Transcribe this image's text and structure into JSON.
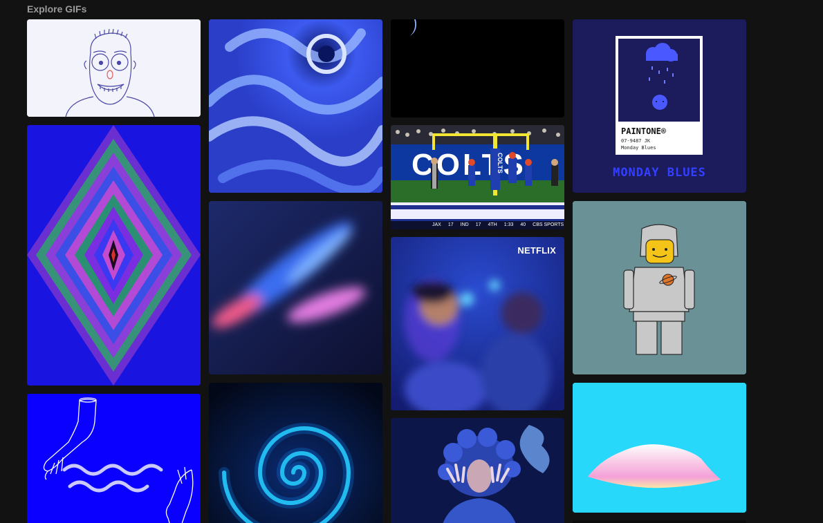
{
  "header": {
    "section_title": "Explore GIFs"
  },
  "gifs": [
    {
      "id": "cartoon-bald-man",
      "column": 1,
      "bg": "#f3f3fb"
    },
    {
      "id": "psychedelic-diamond",
      "column": 1,
      "bg": "#1a14e0"
    },
    {
      "id": "hands-water-line-art",
      "column": 1,
      "bg": "#0a00ff"
    },
    {
      "id": "blue-swirl-abstract",
      "column": 2,
      "bg": "#2a3ec8"
    },
    {
      "id": "blurred-light-streaks",
      "column": 2,
      "bg": "#1a2254"
    },
    {
      "id": "cyan-spiral-tunnel",
      "column": 2,
      "bg": "#030818"
    },
    {
      "id": "dark-crescent",
      "column": 3,
      "bg": "#000000"
    },
    {
      "id": "colts-field-goal",
      "column": 3,
      "bg": "#1f2f8e"
    },
    {
      "id": "netflix-party-scene",
      "column": 3,
      "bg": "#1b2b8c"
    },
    {
      "id": "blue-haired-performer",
      "column": 3,
      "bg": "#0d1648"
    },
    {
      "id": "paintone-monday-blues",
      "column": 4,
      "bg": "#1c1b5c"
    },
    {
      "id": "lego-astronaut-sketch",
      "column": 4,
      "bg": "#6a9196"
    },
    {
      "id": "pink-cloud-cyan",
      "column": 4,
      "bg": "#27d8fa"
    }
  ],
  "netflix": {
    "badge": "NETFLIX"
  },
  "colts": {
    "stadium_text": "COLTS",
    "post_text": "COLTS",
    "score": {
      "away_team": "JAX",
      "away_score": "17",
      "home_team": "IND",
      "home_score": "17",
      "quarter": "4TH",
      "clock": "1:33",
      "play_clock": "40",
      "network": "CBS SPORTS"
    }
  },
  "paintone": {
    "brand": "PAINTONE®",
    "code": "07-9487 JK",
    "name": "Monday Blues",
    "caption": "MONDAY BLUES"
  },
  "colors": {
    "page_bg": "#121212",
    "title_text": "#9a9a9a",
    "monday_blues_accent": "#3340ff"
  }
}
